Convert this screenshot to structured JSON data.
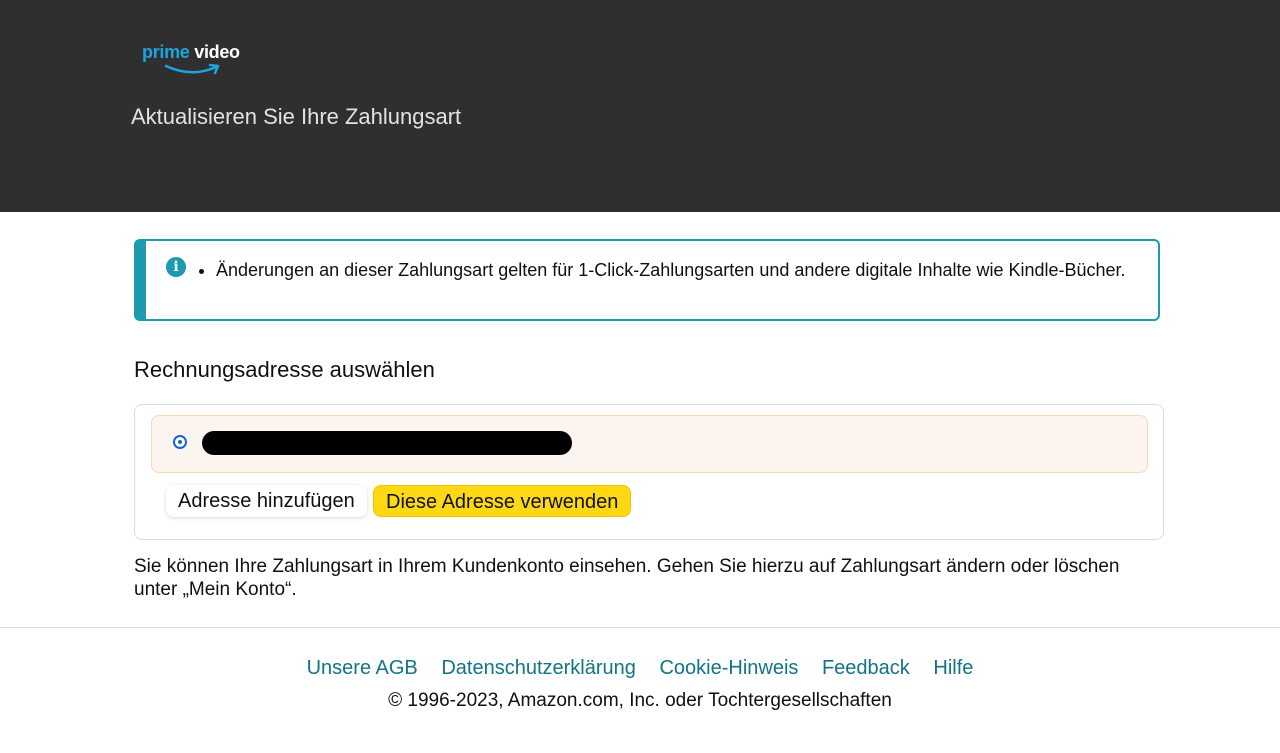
{
  "header": {
    "logo_prime": "prime",
    "logo_video": "video",
    "title": "Aktualisieren Sie Ihre Zahlungsart"
  },
  "info": {
    "icon": "info-icon",
    "text": "Änderungen an dieser Zahlungsart gelten für 1-Click-Zahlungsarten und andere digitale Inhalte wie Kindle-Bücher."
  },
  "billing": {
    "title": "Rechnungsadresse auswählen",
    "add_label": "Adresse hinzufügen",
    "use_label": "Diese Adresse verwenden"
  },
  "note": "Sie können Ihre Zahlungsart in Ihrem Kundenkonto einsehen. Gehen Sie hierzu auf Zahlungsart ändern oder löschen unter „Mein Konto“.",
  "footer": {
    "links": [
      "Unsere AGB",
      "Datenschutzerklärung",
      "Cookie-Hinweis",
      "Feedback",
      "Hilfe"
    ],
    "copyright": "© 1996-2023, Amazon.com, Inc. oder Tochtergesellschaften"
  },
  "colors": {
    "header_bg": "#2f2f2f",
    "accent": "#1d9ab0",
    "link": "#117585",
    "primary_button": "#ffd814"
  }
}
